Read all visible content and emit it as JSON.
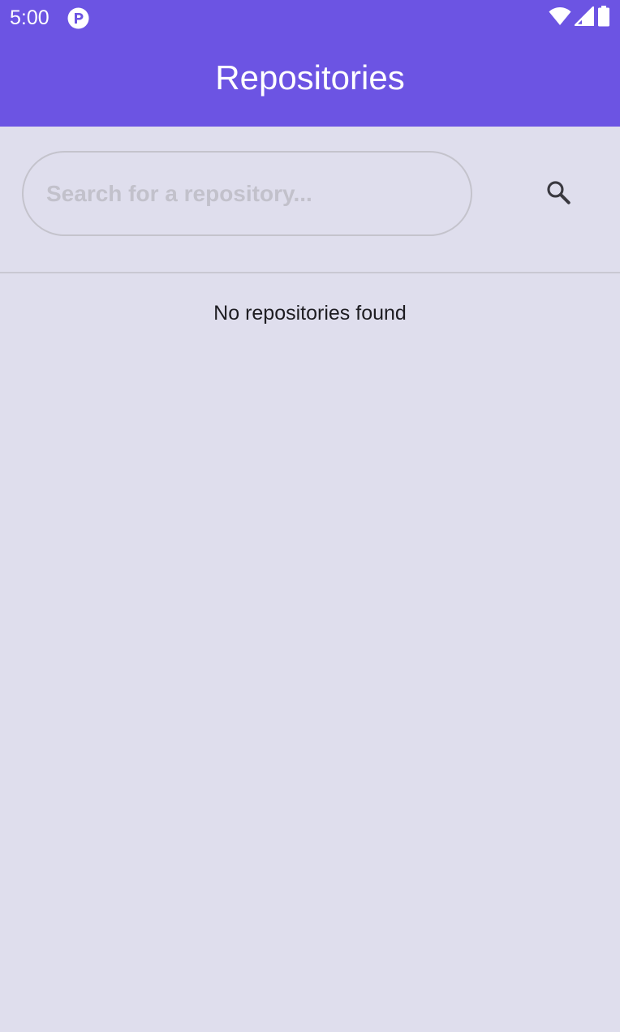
{
  "status_bar": {
    "time": "5:00",
    "icons": [
      "app-notification-icon",
      "wifi-icon",
      "signal-icon",
      "battery-icon"
    ]
  },
  "header": {
    "title": "Repositories"
  },
  "search": {
    "placeholder": "Search for a repository...",
    "value": "",
    "button_icon": "search-icon"
  },
  "results": {
    "empty_message": "No repositories found"
  },
  "colors": {
    "header": "#6c54e3",
    "background": "#dfdeed"
  }
}
